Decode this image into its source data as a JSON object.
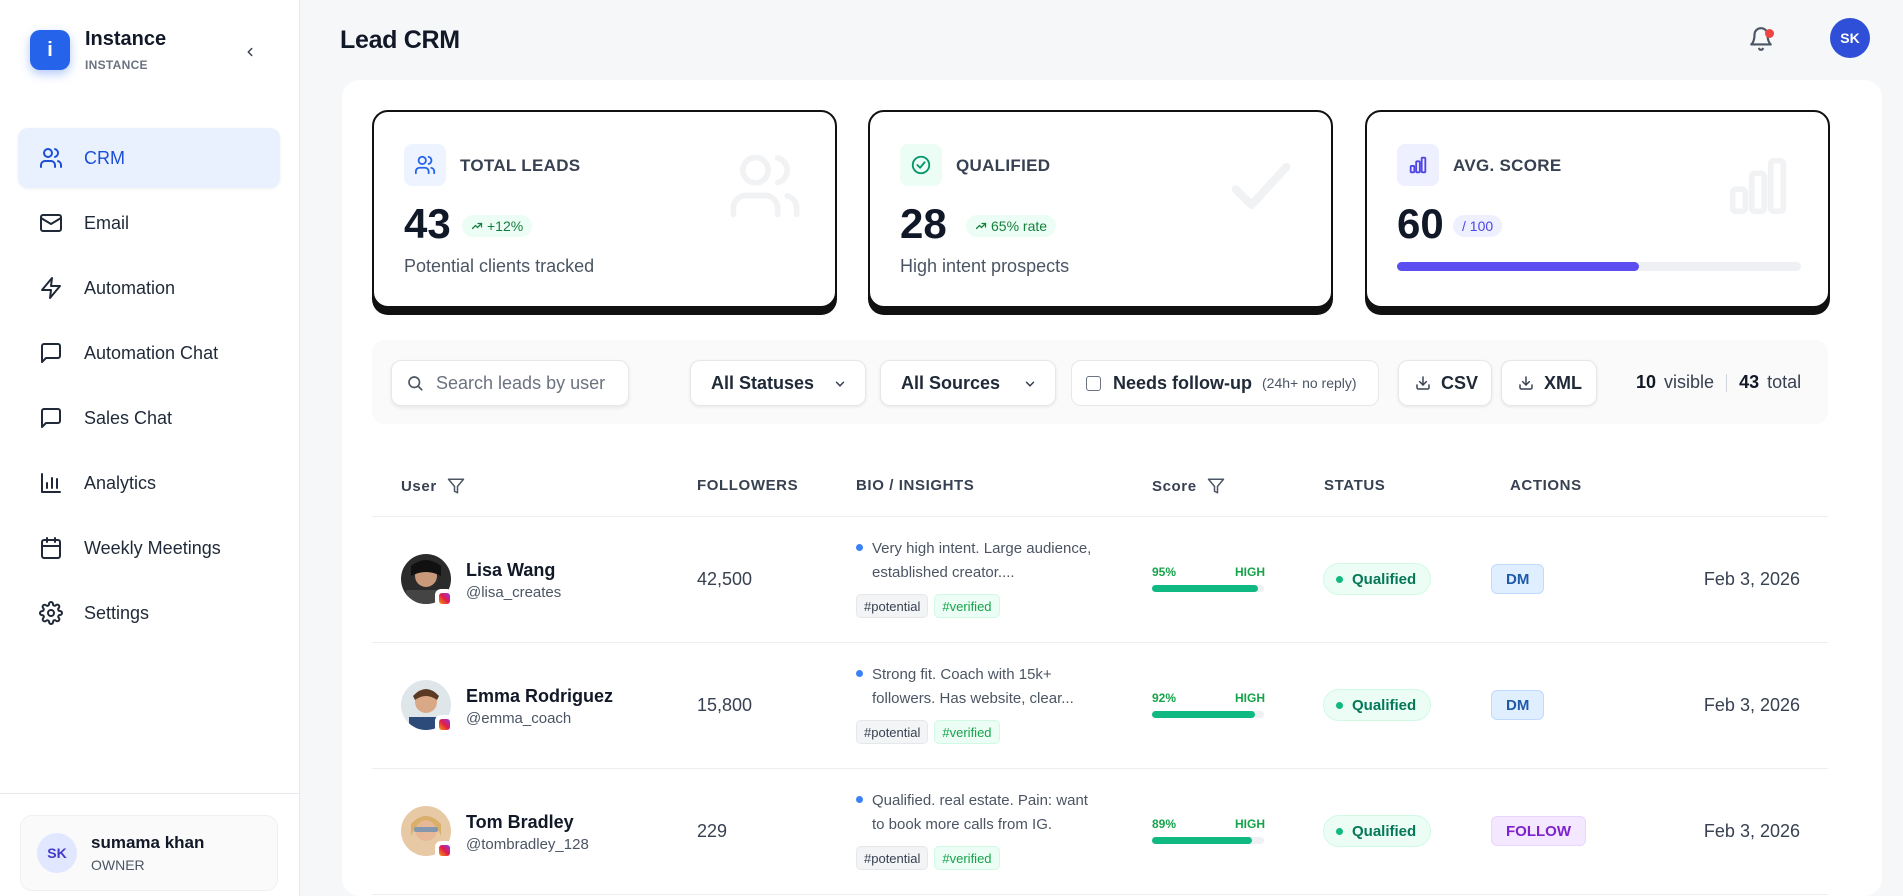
{
  "app": {
    "name": "Instance",
    "sub": "INSTANCE",
    "logo_letter": "i"
  },
  "nav": [
    {
      "label": "CRM",
      "icon": "users-icon",
      "active": true
    },
    {
      "label": "Email",
      "icon": "mail-icon"
    },
    {
      "label": "Automation",
      "icon": "bolt-icon"
    },
    {
      "label": "Automation Chat",
      "icon": "chat-icon"
    },
    {
      "label": "Sales Chat",
      "icon": "chat-icon"
    },
    {
      "label": "Analytics",
      "icon": "bar-chart-icon"
    },
    {
      "label": "Weekly Meetings",
      "icon": "calendar-icon"
    },
    {
      "label": "Settings",
      "icon": "gear-icon"
    }
  ],
  "user": {
    "initials": "SK",
    "name": "sumama khan",
    "role": "OWNER"
  },
  "header": {
    "title": "Lead CRM",
    "avatar_initials": "SK"
  },
  "stats": {
    "total": {
      "label": "TOTAL LEADS",
      "value": "43",
      "chip": "+12%",
      "desc": "Potential clients tracked"
    },
    "qualified": {
      "label": "QUALIFIED",
      "value": "28",
      "chip": "65% rate",
      "desc": "High intent prospects"
    },
    "score": {
      "label": "AVG. SCORE",
      "value": "60",
      "chip": "/ 100",
      "progress": 0.6
    }
  },
  "toolbar": {
    "search_placeholder": "Search leads by user",
    "status_select": "All Statuses",
    "source_select": "All Sources",
    "followup_label": "Needs follow-up",
    "followup_sub": "(24h+ no reply)",
    "csv": "CSV",
    "xml": "XML",
    "visible_count": "10",
    "visible_label": "visible",
    "total_count": "43",
    "total_label": "total"
  },
  "table": {
    "headers": {
      "user": "User",
      "followers": "FOLLOWERS",
      "bio": "BIO / INSIGHTS",
      "score": "Score",
      "status": "STATUS",
      "actions": "ACTIONS"
    },
    "rows": [
      {
        "name": "Lisa Wang",
        "handle": "@lisa_creates",
        "followers": "42,500",
        "bio": "Very high intent. Large audience, established creator....",
        "tag1": "#potential",
        "tag2": "#verified",
        "score_pct": "95%",
        "score_level": "HIGH",
        "score": 0.95,
        "status": "Qualified",
        "action": "DM",
        "date": "Feb 3, 2026"
      },
      {
        "name": "Emma Rodriguez",
        "handle": "@emma_coach",
        "followers": "15,800",
        "bio": "Strong fit. Coach with 15k+ followers. Has website, clear...",
        "tag1": "#potential",
        "tag2": "#verified",
        "score_pct": "92%",
        "score_level": "HIGH",
        "score": 0.92,
        "status": "Qualified",
        "action": "DM",
        "date": "Feb 3, 2026"
      },
      {
        "name": "Tom Bradley",
        "handle": "@tombradley_128",
        "followers": "229",
        "bio": "Qualified. real estate. Pain: want to book more calls from IG.",
        "tag1": "#potential",
        "tag2": "#verified",
        "score_pct": "89%",
        "score_level": "HIGH",
        "score": 0.89,
        "status": "Qualified",
        "action": "FOLLOW",
        "date": "Feb 3, 2026"
      }
    ]
  },
  "colors": {
    "accent": "#2563eb",
    "progress": "#5b4df0",
    "score": "#10b981",
    "qualified": "#047857"
  }
}
